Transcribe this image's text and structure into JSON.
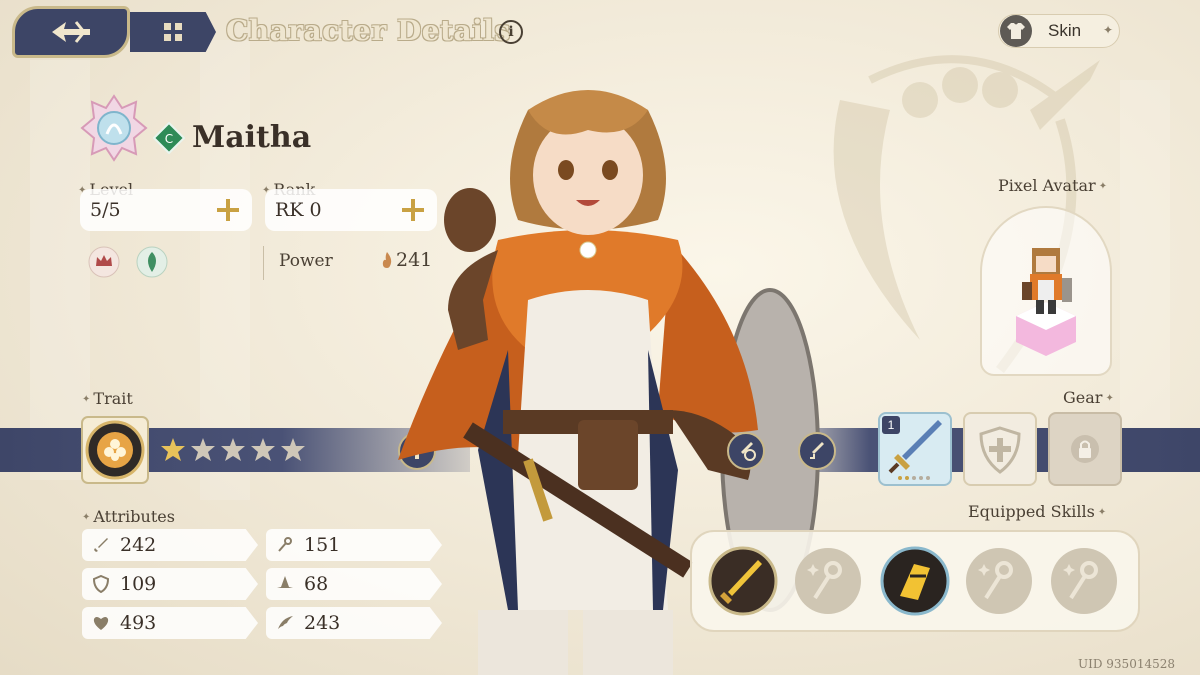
{
  "header": {
    "title": "Character Details",
    "info_glyph": "i",
    "skin_label": "Skin"
  },
  "character": {
    "name": "Maitha",
    "level_label": "Level",
    "level_value": "5/5",
    "rank_label": "Rank",
    "rank_value": "RK 0",
    "power_label": "Power",
    "power_value": "241"
  },
  "trait": {
    "label": "Trait",
    "stars_filled": 1,
    "stars_total": 5
  },
  "attributes": {
    "label": "Attributes",
    "items": [
      {
        "icon": "sword-icon",
        "value": "242"
      },
      {
        "icon": "staff-icon",
        "value": "151"
      },
      {
        "icon": "shield-icon",
        "value": "109"
      },
      {
        "icon": "hat-icon",
        "value": "68"
      },
      {
        "icon": "heart-icon",
        "value": "493"
      },
      {
        "icon": "wing-icon",
        "value": "243"
      }
    ]
  },
  "right": {
    "pixel_avatar_label": "Pixel Avatar",
    "gear_label": "Gear",
    "weapon_level": "1",
    "equipped_skills_label": "Equipped Skills"
  },
  "footer": {
    "uid": "UID 935014528"
  },
  "colors": {
    "navy": "#3d4566",
    "gold": "#c9b98a",
    "star_gold": "#e8c25a",
    "star_empty": "#cfc7b8"
  }
}
